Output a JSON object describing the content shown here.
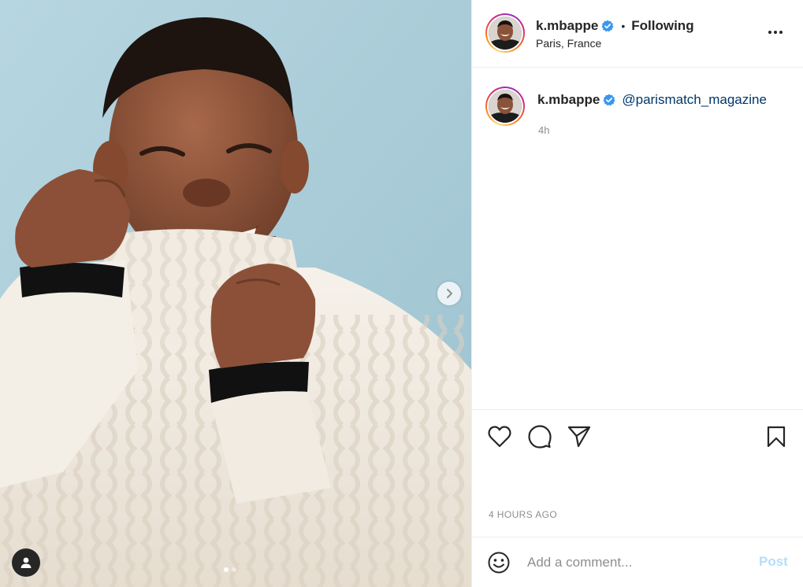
{
  "post": {
    "author": {
      "username": "k.mbappe",
      "verified": true,
      "verified_color": "#3897f0",
      "avatar_icon": "profile-photo"
    },
    "follow_status": "Following",
    "separator": "•",
    "location": "Paris, France",
    "caption": {
      "username": "k.mbappe",
      "mention": "@parismatch_magazine",
      "relative_time": "4h"
    },
    "timestamp": "4 HOURS AGO"
  },
  "media": {
    "description_icon": "portrait-photo",
    "carousel": {
      "total": 2,
      "current": 1
    },
    "next_icon": "chevron-right-icon",
    "tag_icon": "user-tag-icon"
  },
  "actions": {
    "like_icon": "heart-icon",
    "comment_icon": "comment-icon",
    "share_icon": "paper-plane-icon",
    "save_icon": "bookmark-icon"
  },
  "comment_box": {
    "placeholder": "Add a comment...",
    "post_label": "Post",
    "emoji_icon": "smiley-icon"
  },
  "colors": {
    "text": "#262626",
    "muted": "#8e8e8e",
    "link": "#00376b",
    "post_disabled": "#b2dffc",
    "background_photo": "#a9cbd7"
  }
}
